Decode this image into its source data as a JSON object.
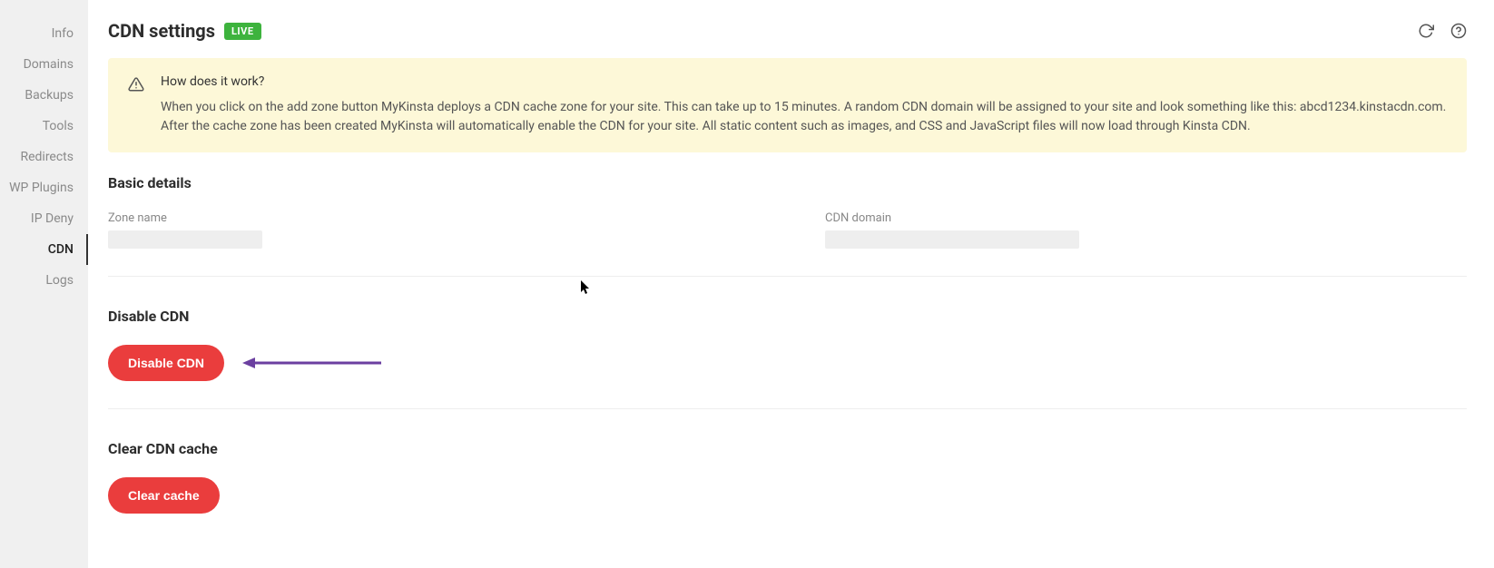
{
  "sidebar": {
    "items": [
      {
        "label": "Info",
        "active": false
      },
      {
        "label": "Domains",
        "active": false
      },
      {
        "label": "Backups",
        "active": false
      },
      {
        "label": "Tools",
        "active": false
      },
      {
        "label": "Redirects",
        "active": false
      },
      {
        "label": "WP Plugins",
        "active": false
      },
      {
        "label": "IP Deny",
        "active": false
      },
      {
        "label": "CDN",
        "active": true
      },
      {
        "label": "Logs",
        "active": false
      }
    ]
  },
  "header": {
    "title": "CDN settings",
    "badge": "LIVE"
  },
  "notice": {
    "title": "How does it work?",
    "body": "When you click on the add zone button MyKinsta deploys a CDN cache zone for your site. This can take up to 15 minutes. A random CDN domain will be assigned to your site and look something like this: abcd1234.kinstacdn.com. After the cache zone has been created MyKinsta will automatically enable the CDN for your site. All static content such as images, and CSS and JavaScript files will now load through Kinsta CDN."
  },
  "sections": {
    "basic_details": {
      "heading": "Basic details",
      "labels": {
        "zone": "Zone name",
        "domain": "CDN domain"
      }
    },
    "disable": {
      "heading": "Disable CDN",
      "button": "Disable CDN"
    },
    "clear_cache": {
      "heading": "Clear CDN cache",
      "button": "Clear cache"
    }
  }
}
